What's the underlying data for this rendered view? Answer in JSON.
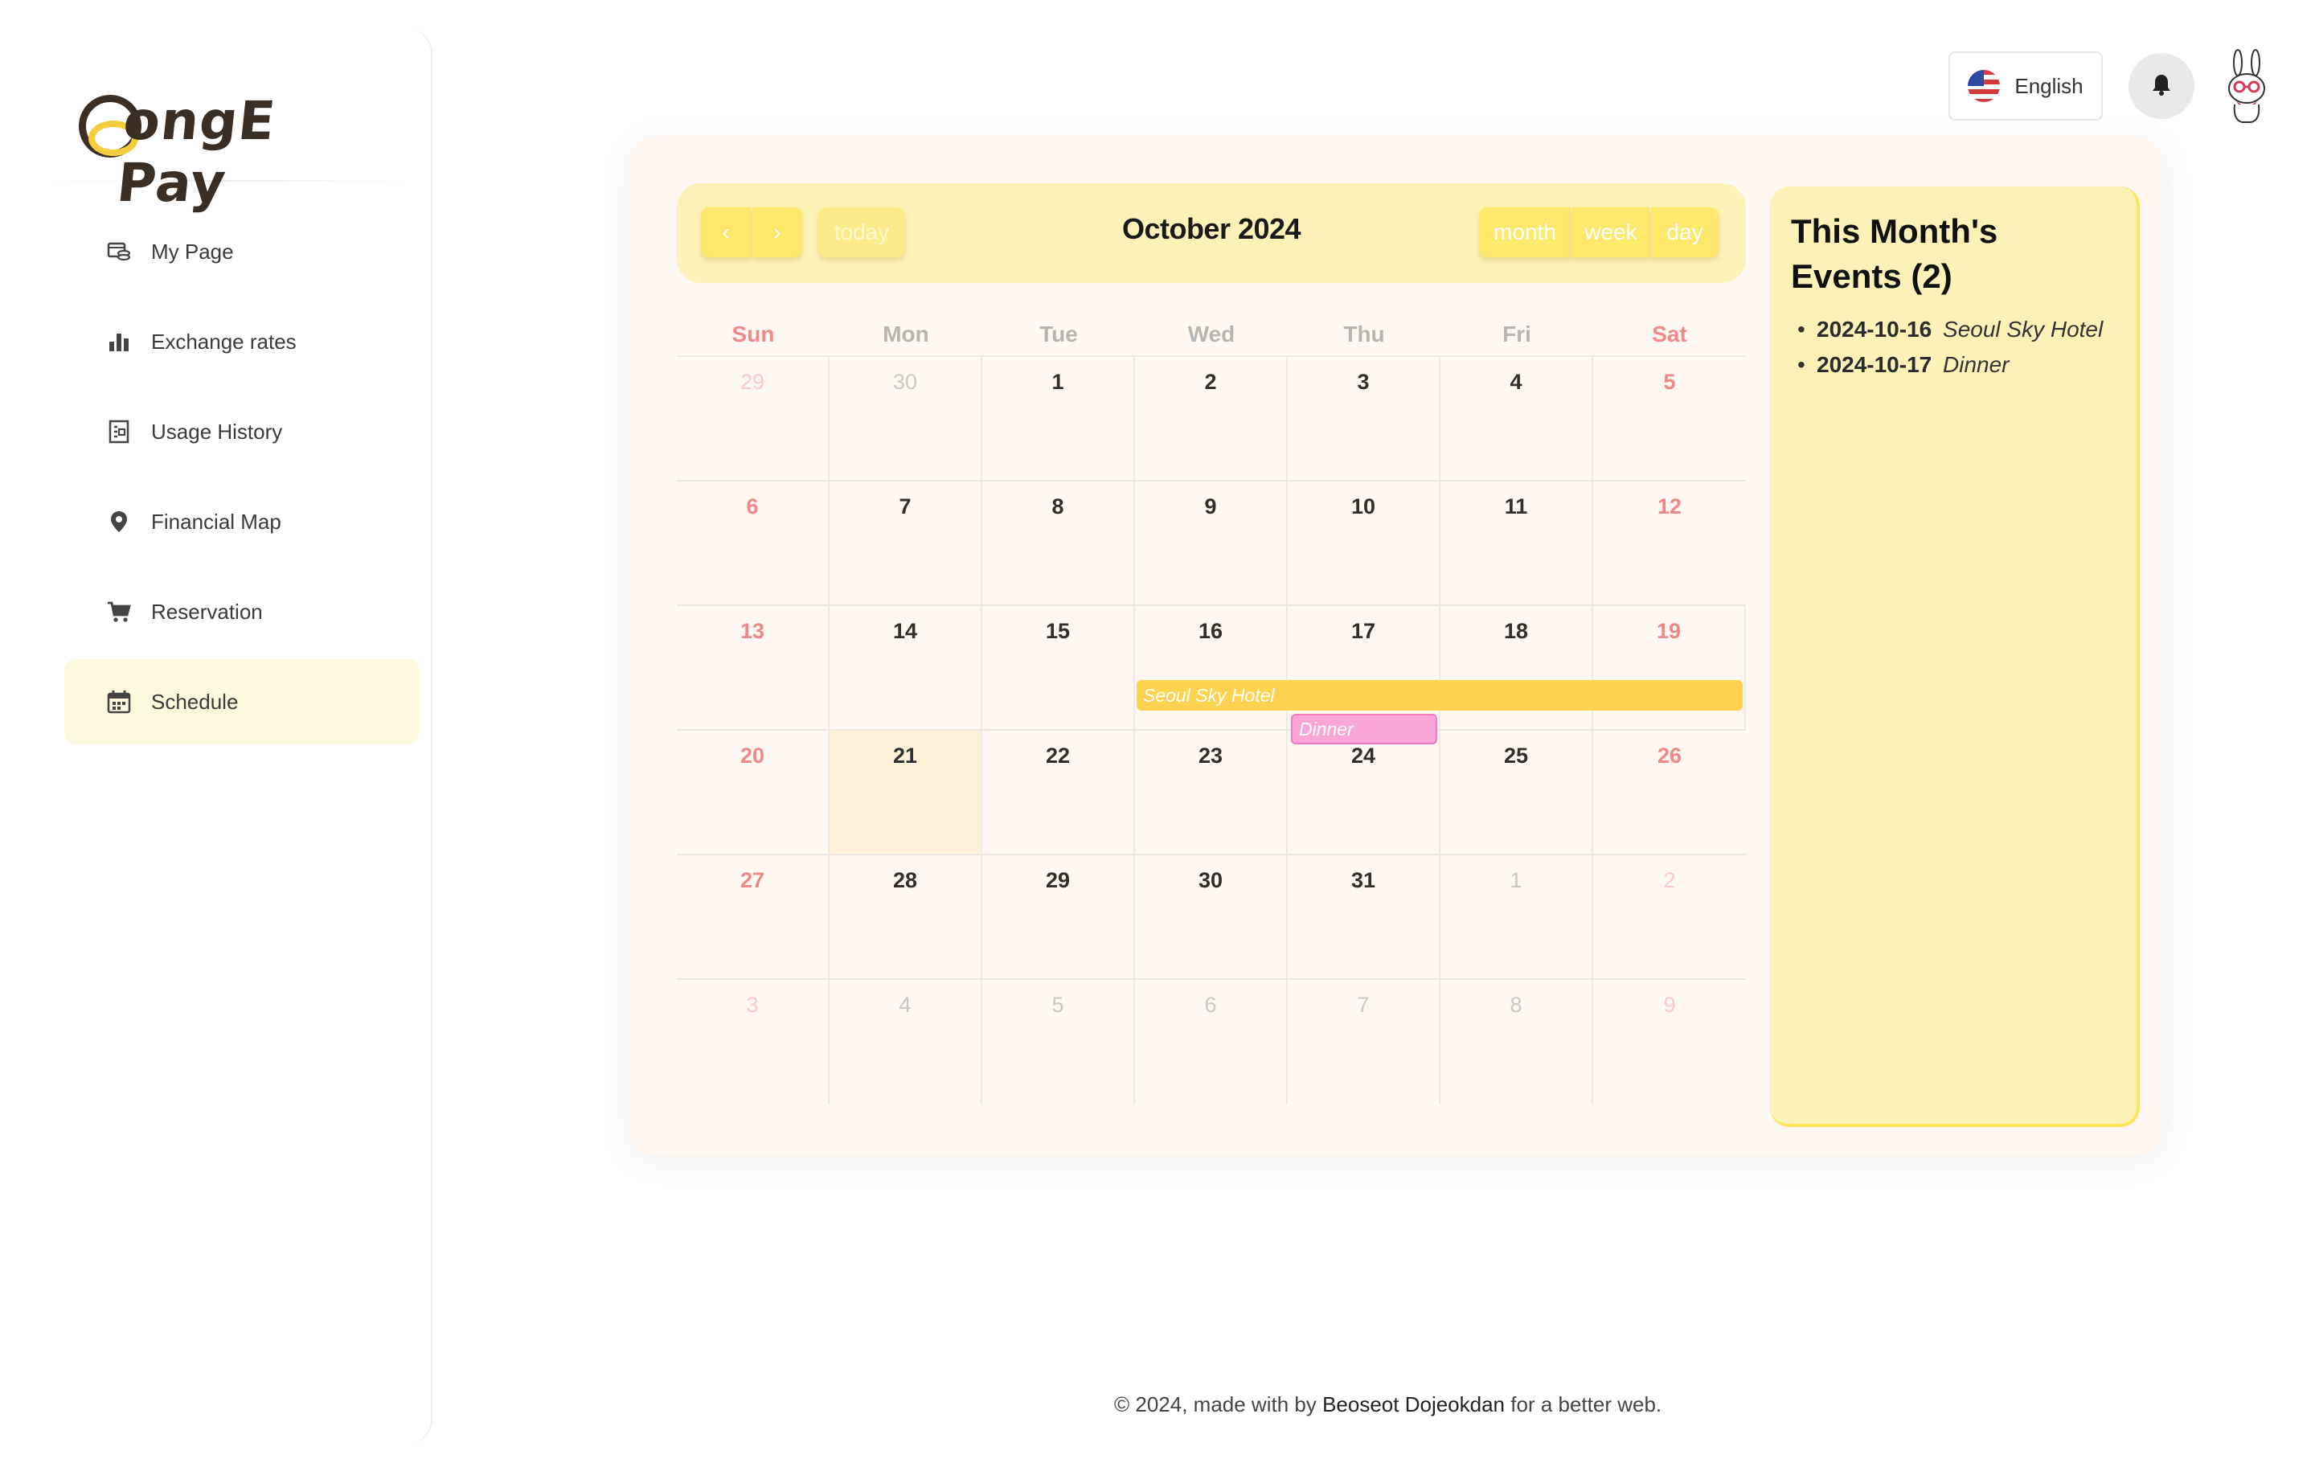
{
  "logo": {
    "text": "ongE Pay"
  },
  "sidebar": {
    "items": [
      {
        "label": "My Page",
        "icon": "wallet-icon"
      },
      {
        "label": "Exchange rates",
        "icon": "bar-chart-icon"
      },
      {
        "label": "Usage History",
        "icon": "receipt-icon"
      },
      {
        "label": "Financial Map",
        "icon": "map-pin-icon"
      },
      {
        "label": "Reservation",
        "icon": "cart-icon"
      },
      {
        "label": "Schedule",
        "icon": "calendar-icon",
        "active": true
      }
    ]
  },
  "header": {
    "language": "English",
    "bell_icon": "bell-icon",
    "avatar_icon": "bunny-avatar-icon"
  },
  "calendar": {
    "title": "October 2024",
    "prev_label": "‹",
    "next_label": "›",
    "today_label": "today",
    "views": {
      "month": "month",
      "week": "week",
      "day": "day"
    },
    "weekdays": [
      "Sun",
      "Mon",
      "Tue",
      "Wed",
      "Thu",
      "Fri",
      "Sat"
    ],
    "weeks": [
      [
        "29",
        "30",
        "1",
        "2",
        "3",
        "4",
        "5"
      ],
      [
        "6",
        "7",
        "8",
        "9",
        "10",
        "11",
        "12"
      ],
      [
        "13",
        "14",
        "15",
        "16",
        "17",
        "18",
        "19"
      ],
      [
        "20",
        "21",
        "22",
        "23",
        "24",
        "25",
        "26"
      ],
      [
        "27",
        "28",
        "29",
        "30",
        "31",
        "1",
        "2"
      ],
      [
        "3",
        "4",
        "5",
        "6",
        "7",
        "8",
        "9"
      ]
    ],
    "today": "21",
    "events": [
      {
        "title": "Seoul Sky Hotel",
        "start": "2024-10-16",
        "end": "2024-10-19",
        "color": "#fdd24e"
      },
      {
        "title": "Dinner",
        "start": "2024-10-17",
        "end": "2024-10-17",
        "color": "#f9a5d6"
      }
    ]
  },
  "side_panel": {
    "title": "This Month's Events (2)",
    "events": [
      {
        "date": "2024-10-16",
        "name": "Seoul Sky Hotel"
      },
      {
        "date": "2024-10-17",
        "name": "Dinner"
      }
    ]
  },
  "footer": {
    "prefix": "© 2024, made with by ",
    "author": "Beoseot Dojeokdan",
    "suffix": " for a better web."
  },
  "colors": {
    "accent_yellow": "#fde86b",
    "panel_yellow": "#fcf1b6",
    "weekend_red": "#ee8888",
    "active_nav_bg": "#fdf9de"
  }
}
